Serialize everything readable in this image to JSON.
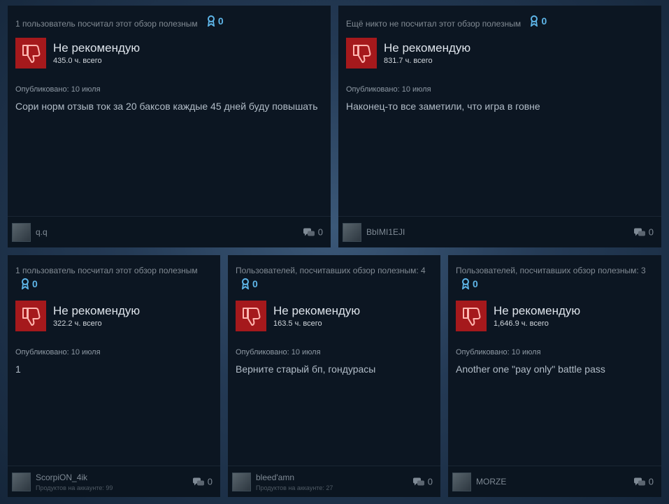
{
  "reviews": [
    {
      "helpful": "1 пользователь посчитал этот обзор полезным",
      "awards": "0",
      "recommendation": "Не рекомендую",
      "hours": "435.0 ч. всего",
      "posted": "Опубликовано: 10 июля",
      "text": "Сори норм отзыв ток за 20 баксов каждые 45 дней буду повышать",
      "username": "q.q",
      "products": "",
      "comments": "0"
    },
    {
      "helpful": "Ещё никто не посчитал этот обзор полезным",
      "awards": "0",
      "recommendation": "Не рекомендую",
      "hours": "831.7 ч. всего",
      "posted": "Опубликовано: 10 июля",
      "text": "Наконец-то все заметили, что игра в говне",
      "username": "BbIMI1EJI",
      "products": "",
      "comments": "0"
    },
    {
      "helpful": "1 пользователь посчитал этот обзор полезным",
      "awards": "0",
      "recommendation": "Не рекомендую",
      "hours": "322.2 ч. всего",
      "posted": "Опубликовано: 10 июля",
      "text": "1",
      "username": "ScorpiON_4ik",
      "products": "Продуктов на аккаунте: 99",
      "comments": "0"
    },
    {
      "helpful": "Пользователей, посчитавших обзор полезным: 4",
      "awards": "0",
      "recommendation": "Не рекомендую",
      "hours": "163.5 ч. всего",
      "posted": "Опубликовано: 10 июля",
      "text": "Верните старый бп, гондурасы",
      "username": "bleed'amn",
      "products": "Продуктов на аккаунте: 27",
      "comments": "0"
    },
    {
      "helpful": "Пользователей, посчитавших обзор полезным: 3",
      "awards": "0",
      "recommendation": "Не рекомендую",
      "hours": "1,646.9 ч. всего",
      "posted": "Опубликовано: 10 июля",
      "text": "Another one \"pay only\" battle pass",
      "username": "MORZE",
      "products": "",
      "comments": "0"
    }
  ],
  "colors": {
    "thumb_bg": "#a5191c",
    "award": "#5eb5e8",
    "card_bg": "#0c1622"
  },
  "icons": {
    "thumb": "thumbs-down-icon",
    "award": "award-ribbon-icon",
    "comment": "comment-bubbles-icon"
  }
}
